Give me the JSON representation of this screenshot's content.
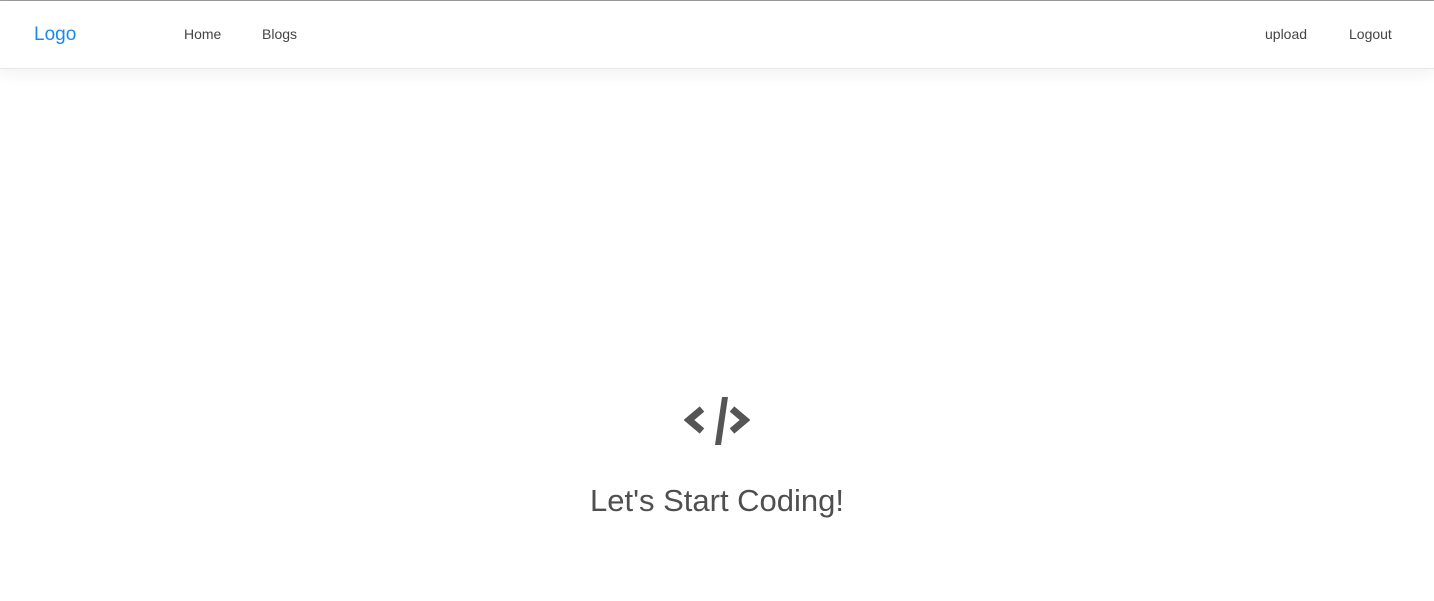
{
  "navbar": {
    "logo": "Logo",
    "links": [
      {
        "label": "Home"
      },
      {
        "label": "Blogs"
      }
    ],
    "right_links": [
      {
        "label": "upload"
      },
      {
        "label": "Logout"
      }
    ]
  },
  "hero": {
    "icon": "code-icon",
    "title": "Let's Start Coding!"
  },
  "colors": {
    "logo": "#1a8ae6",
    "text": "#444444",
    "icon": "#555555"
  }
}
